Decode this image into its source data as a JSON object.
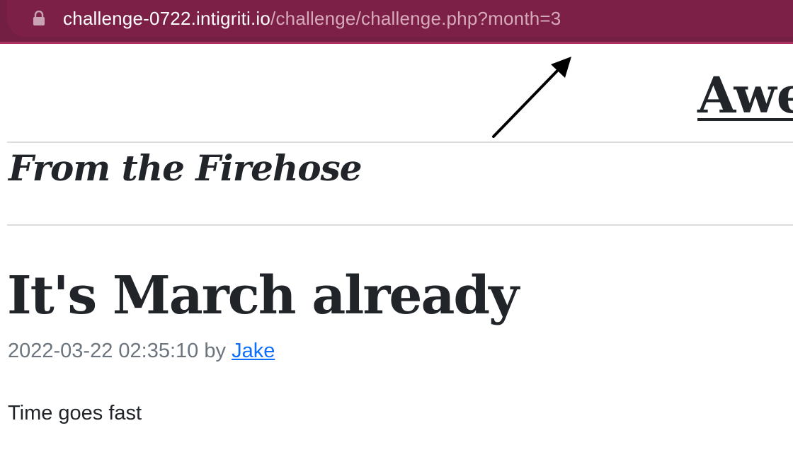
{
  "browser": {
    "url_host": "challenge-0722.intigriti.io",
    "url_path": "/challenge/challenge.php?month=3",
    "lock_icon": "lock-icon",
    "colors": {
      "bar": "#731f43",
      "bar_accent": "#a8315f"
    }
  },
  "page": {
    "site_title": "Awe",
    "section_heading": "From the Firehose",
    "post": {
      "title": "It's March already",
      "timestamp": "2022-03-22 02:35:10",
      "by": "by",
      "author": "Jake",
      "body": "Time goes fast"
    }
  },
  "annotation": {
    "arrow_icon": "arrow-icon"
  }
}
